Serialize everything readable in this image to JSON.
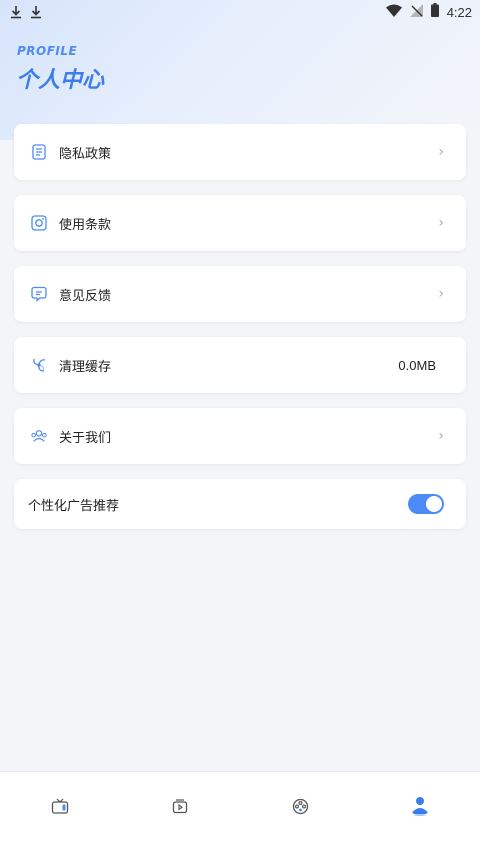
{
  "status_bar": {
    "time": "4:22",
    "icons": [
      "download-icon",
      "download-icon",
      "wifi-icon",
      "signal-off-icon",
      "battery-icon"
    ]
  },
  "header": {
    "title_en": "PROFILE",
    "title_cn": "个人中心"
  },
  "menu": [
    {
      "label": "隐私政策",
      "icon": "document-icon"
    },
    {
      "label": "使用条款",
      "icon": "terms-icon"
    },
    {
      "label": "意见反馈",
      "icon": "feedback-icon"
    },
    {
      "label": "清理缓存",
      "icon": "clean-icon",
      "value": "0.0MB"
    },
    {
      "label": "关于我们",
      "icon": "team-icon"
    }
  ],
  "ad_setting": {
    "label": "个性化广告推荐",
    "enabled": true
  },
  "tabs": [
    {
      "icon": "tv-icon",
      "active": false
    },
    {
      "icon": "video-icon",
      "active": false
    },
    {
      "icon": "film-reel-icon",
      "active": false
    },
    {
      "icon": "profile-icon",
      "active": true
    }
  ],
  "colors": {
    "accent": "#4d8af5",
    "header_text": "#3c7deb",
    "background": "#f3f5f9"
  }
}
